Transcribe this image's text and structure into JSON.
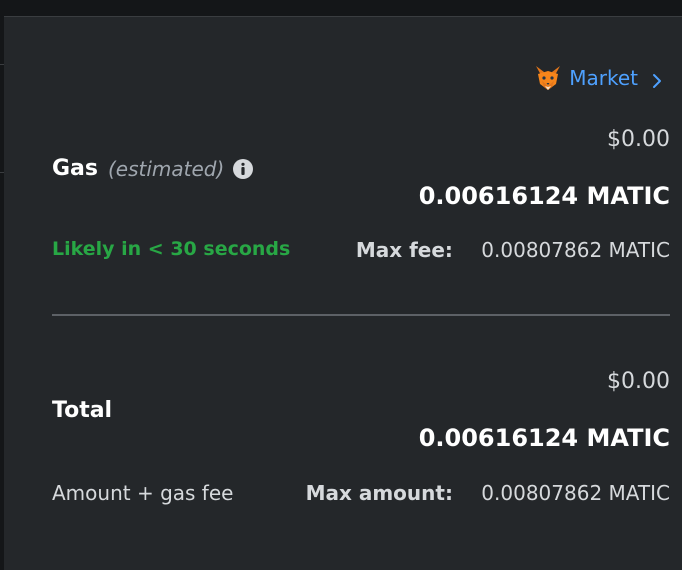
{
  "gas": {
    "market_label": "Market",
    "label": "Gas",
    "estimated_label": "(estimated)",
    "usd": "$0.00",
    "amount": "0.00616124 MATIC",
    "likely_text": "Likely in < 30 seconds",
    "max_fee_label": "Max fee:",
    "max_fee_value": "0.00807862 MATIC"
  },
  "total": {
    "label": "Total",
    "usd": "$0.00",
    "amount": "0.00616124 MATIC",
    "sub_label": "Amount + gas fee",
    "max_amount_label": "Max amount:",
    "max_amount_value": "0.00807862 MATIC"
  },
  "icons": {
    "market": "fox-icon",
    "market_arrow": "chevron-right-icon",
    "gas_info": "info-icon"
  },
  "colors": {
    "background": "#24272a",
    "link": "#4ea1ff",
    "success": "#28a745",
    "text": "#ffffff",
    "muted": "#d6d9dc"
  }
}
